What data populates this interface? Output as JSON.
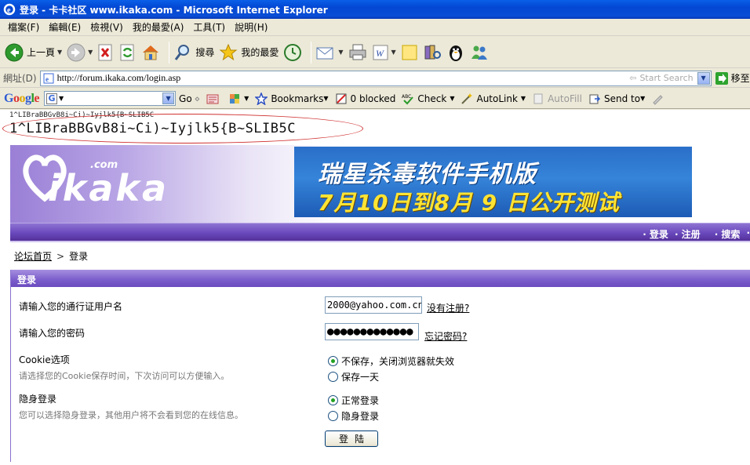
{
  "window": {
    "title": "登录 - 卡卡社区 www.ikaka.com - Microsoft Internet Explorer"
  },
  "menu": [
    "檔案(F)",
    "編輯(E)",
    "檢視(V)",
    "我的最愛(A)",
    "工具(T)",
    "說明(H)"
  ],
  "toolbar": {
    "back_label": "上一頁",
    "search_label": "搜尋",
    "favorites_label": "我的最愛"
  },
  "address": {
    "label": "網址(D)",
    "url": "http://forum.ikaka.com/login.asp",
    "search_placeholder": "Start Search",
    "go_label": "移至"
  },
  "googlebar": {
    "logo": "Google",
    "go_label": "Go",
    "bookmarks_label": "Bookmarks",
    "blocked_label": "0 blocked",
    "check_label": "Check",
    "autolink_label": "AutoLink",
    "autofill_label": "AutoFill",
    "sendto_label": "Send to"
  },
  "page": {
    "encoded_small": "1^LIBraBBGvB8i~Ci)~Iyjlk5{B~SLIB5C",
    "encoded_big": "1^LIBraBBGvB8i~Ci)~Iyjlk5{B~SLIB5C",
    "logo_text": "ikaka",
    "logo_com": ".com",
    "banner_line1": "瑞星杀毒软件手机版",
    "banner_line2": "7月10日到8月 9 日公开测试",
    "nav_links": [
      "· 登录",
      "· 注册",
      "· 搜索",
      "·"
    ],
    "breadcrumb_home": "论坛首页",
    "breadcrumb_current": "登录",
    "panel_title": "登录",
    "username_label": "请输入您的通行证用户名",
    "username_value": "2000@yahoo.com.cn",
    "register_link": "没有注册?",
    "password_label": "请输入您的密码",
    "password_value": "●●●●●●●●●●●●●",
    "forgot_link": "忘记密码?",
    "cookie_label": "Cookie选项",
    "cookie_sub": "请选择您的Cookie保存时间，下次访问可以方便输入。",
    "cookie_opt1": "不保存，关闭浏览器就失效",
    "cookie_opt2": "保存一天",
    "hidden_label": "隐身登录",
    "hidden_sub": "您可以选择隐身登录，其他用户将不会看到您的在线信息。",
    "hidden_opt1": "正常登录",
    "hidden_opt2": "隐身登录",
    "submit_label": "登陆"
  }
}
